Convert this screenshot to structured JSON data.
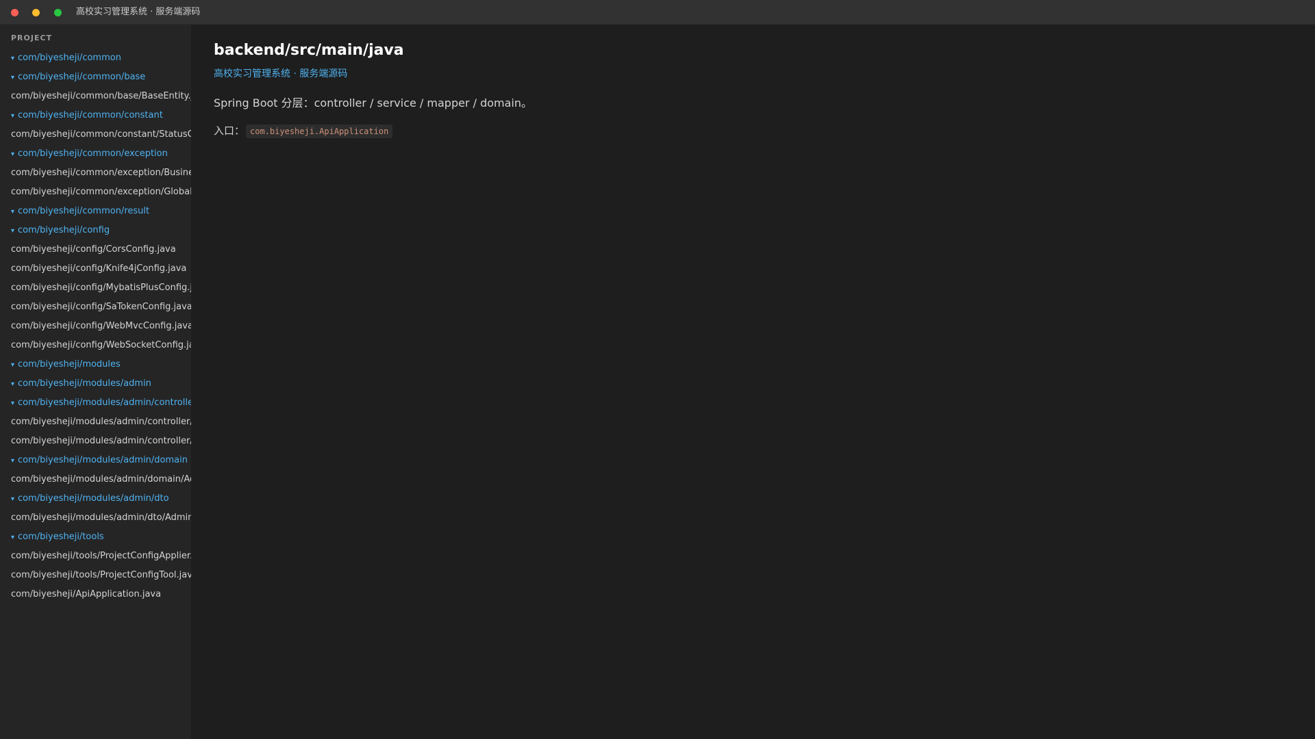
{
  "window": {
    "title": "高校实习管理系统 · 服务端源码"
  },
  "sidebar": {
    "header": "PROJECT",
    "items": [
      {
        "label": "com/biyesheji/common",
        "type": "folder"
      },
      {
        "label": "com/biyesheji/common/base",
        "type": "folder"
      },
      {
        "label": "com/biyesheji/common/base/BaseEntity.java",
        "type": "file"
      },
      {
        "label": "com/biyesheji/common/constant",
        "type": "folder"
      },
      {
        "label": "com/biyesheji/common/constant/StatusConstant.java",
        "type": "file"
      },
      {
        "label": "com/biyesheji/common/exception",
        "type": "folder"
      },
      {
        "label": "com/biyesheji/common/exception/BusinessException.java",
        "type": "file"
      },
      {
        "label": "com/biyesheji/common/exception/GlobalExceptionHandler.java",
        "type": "file"
      },
      {
        "label": "com/biyesheji/common/result",
        "type": "folder"
      },
      {
        "label": "com/biyesheji/config",
        "type": "folder"
      },
      {
        "label": "com/biyesheji/config/CorsConfig.java",
        "type": "file"
      },
      {
        "label": "com/biyesheji/config/Knife4jConfig.java",
        "type": "file"
      },
      {
        "label": "com/biyesheji/config/MybatisPlusConfig.java",
        "type": "file"
      },
      {
        "label": "com/biyesheji/config/SaTokenConfig.java",
        "type": "file"
      },
      {
        "label": "com/biyesheji/config/WebMvcConfig.java",
        "type": "file"
      },
      {
        "label": "com/biyesheji/config/WebSocketConfig.java",
        "type": "file"
      },
      {
        "label": "com/biyesheji/modules",
        "type": "folder"
      },
      {
        "label": "com/biyesheji/modules/admin",
        "type": "folder"
      },
      {
        "label": "com/biyesheji/modules/admin/controller",
        "type": "folder"
      },
      {
        "label": "com/biyesheji/modules/admin/controller/AdminController.java",
        "type": "file"
      },
      {
        "label": "com/biyesheji/modules/admin/controller/SystemController.java",
        "type": "file"
      },
      {
        "label": "com/biyesheji/modules/admin/domain",
        "type": "folder"
      },
      {
        "label": "com/biyesheji/modules/admin/domain/Admin.java",
        "type": "file"
      },
      {
        "label": "com/biyesheji/modules/admin/dto",
        "type": "folder"
      },
      {
        "label": "com/biyesheji/modules/admin/dto/AdminDTO.java",
        "type": "file"
      },
      {
        "label": "com/biyesheji/tools",
        "type": "folder"
      },
      {
        "label": "com/biyesheji/tools/ProjectConfigApplier.java",
        "type": "file"
      },
      {
        "label": "com/biyesheji/tools/ProjectConfigTool.java",
        "type": "file"
      },
      {
        "label": "com/biyesheji/ApiApplication.java",
        "type": "file"
      }
    ]
  },
  "main": {
    "title": "backend/src/main/java",
    "subtitle": "高校实习管理系统 · 服务端源码",
    "description": "Spring Boot 分层：controller / service / mapper / domain。",
    "entry_label": "入口：",
    "entry_code": "com.biyesheji.ApiApplication"
  },
  "icons": {
    "folder_arrow": "▾"
  },
  "colors": {
    "folder": "#4fb3f0",
    "code": "#ce9178",
    "background": "#1e1e1e",
    "sidebar": "#252526"
  }
}
